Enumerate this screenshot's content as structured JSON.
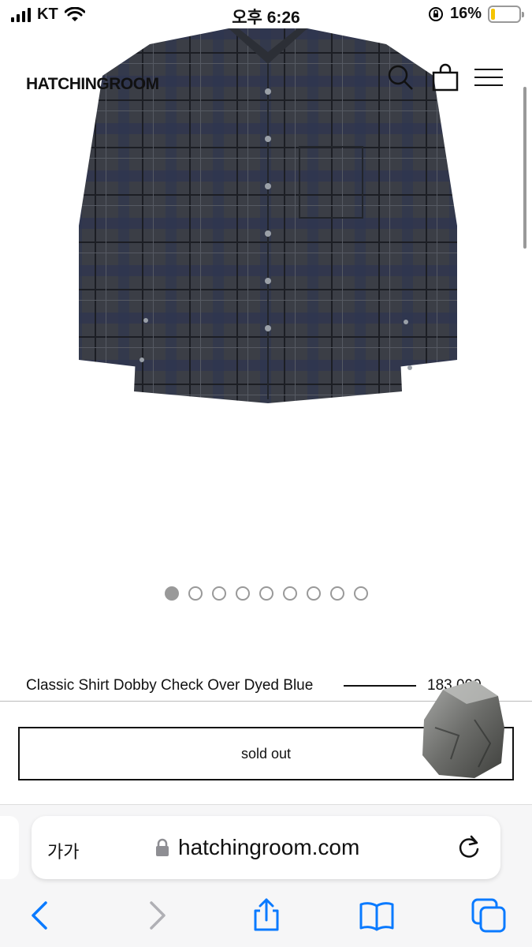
{
  "status_bar": {
    "carrier": "KT",
    "time": "오후 6:26",
    "battery": "16%",
    "battery_level": 0.16
  },
  "header": {
    "logo": "HATCHINGROOM",
    "icons": [
      "search-icon",
      "shopping-bag-icon",
      "menu-icon"
    ]
  },
  "gallery": {
    "image": "plaid-shirt-photo",
    "dot_count": 9,
    "active_index": 0
  },
  "product": {
    "name": "Classic Shirt Dobby Check Over Dyed Blue",
    "price": "183,000",
    "button_label": "sold out"
  },
  "safari": {
    "text_size_label": "가가",
    "url": "hatchingroom.com",
    "toolbar_icons": [
      "back-icon",
      "forward-icon",
      "share-icon",
      "bookmarks-icon",
      "tabs-icon"
    ]
  },
  "colors": {
    "accent": "#0a7aff",
    "shirt": "#3a3d45"
  }
}
